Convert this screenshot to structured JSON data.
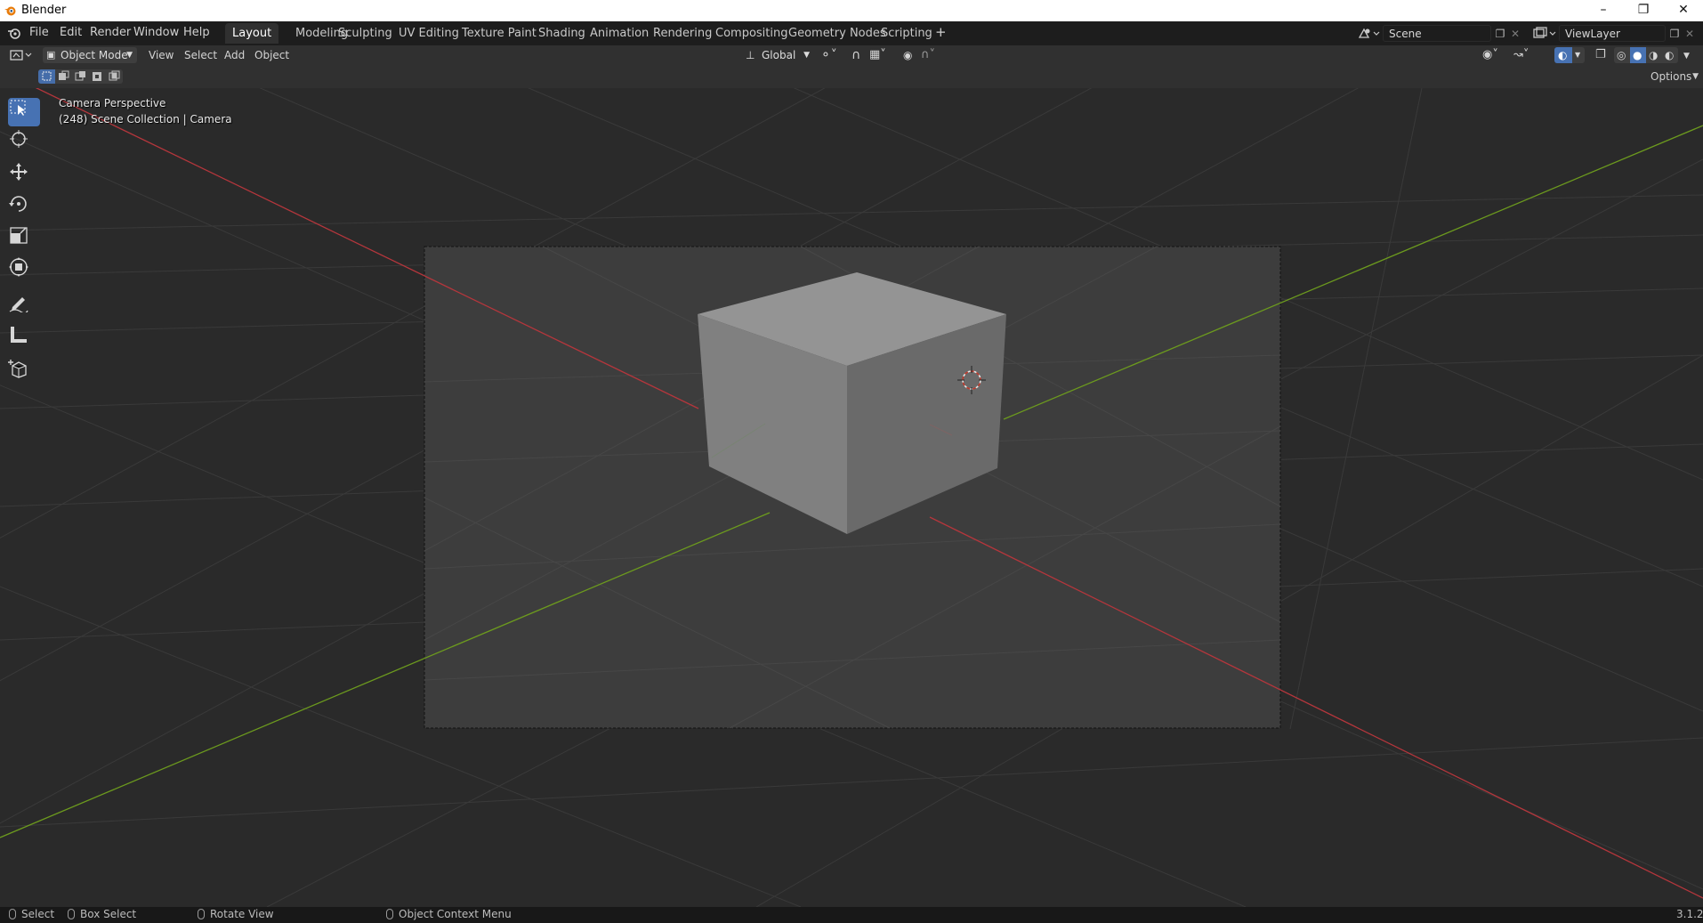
{
  "window": {
    "title": "Blender",
    "icons": {
      "app": "blender-logo-icon",
      "minimize": "minimize-icon",
      "maximize": "restore-icon",
      "close": "close-icon"
    }
  },
  "menubar": {
    "items": [
      "File",
      "Edit",
      "Render",
      "Window",
      "Help"
    ]
  },
  "workspaces": {
    "tabs": [
      "Layout",
      "Modeling",
      "Sculpting",
      "UV Editing",
      "Texture Paint",
      "Shading",
      "Animation",
      "Rendering",
      "Compositing",
      "Geometry Nodes",
      "Scripting"
    ],
    "active": "Layout",
    "add_label": "+"
  },
  "scene": {
    "name": "Scene"
  },
  "view_layer": {
    "name": "ViewLayer"
  },
  "viewport_header": {
    "mode": "Object Mode",
    "menus": [
      "View",
      "Select",
      "Add",
      "Object"
    ],
    "transform_orientation": "Global",
    "options_label": "Options"
  },
  "viewport": {
    "overlay_line1": "Camera Perspective",
    "overlay_line2": "(248) Scene Collection | Camera",
    "accent_color": "#4772b3",
    "x_axis_color": "#b5363c",
    "y_axis_color": "#6c9a1e"
  },
  "tools": [
    "select-box-icon",
    "cursor-icon",
    "move-icon",
    "rotate-icon",
    "scale-icon",
    "transform-icon",
    "annotate-icon",
    "measure-icon",
    "add-cube-icon"
  ],
  "statusbar": {
    "select": "Select",
    "box_select": "Box Select",
    "rotate_view": "Rotate View",
    "context_menu": "Object Context Menu",
    "version": "3.1.2"
  }
}
